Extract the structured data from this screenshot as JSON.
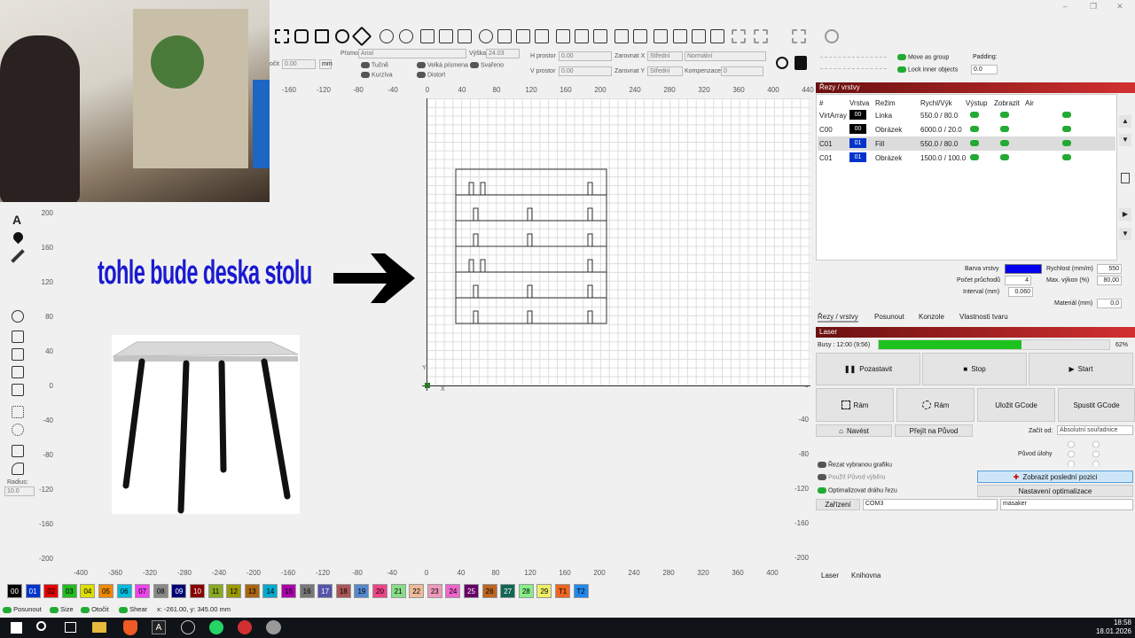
{
  "window": {
    "controls": [
      "–",
      "❐",
      "✕"
    ]
  },
  "toolbar": {
    "font_label": "Písmo",
    "font_value": "Arial",
    "height_label": "Výška",
    "height_value": "24.03",
    "h_space_label": "H prostor",
    "h_space_value": "0.00",
    "v_space_label": "V prostor",
    "v_space_value": "0.00",
    "align_x_label": "Zarovnat X",
    "align_x_value": "Střední",
    "align_y_label": "Zarovnat Y",
    "align_y_value": "Střední",
    "normal_value": "Normální",
    "compensation_label": "Kompenzace",
    "compensation_value": "0",
    "bold": "Tučně",
    "italic": "Kurzíva",
    "caps": "Velká písmena",
    "welded": "Svařeno",
    "distort": "Distort",
    "rotate_label": "očit",
    "rotate_value": "0.00",
    "unit": "mm",
    "move_as_group": "Move as group",
    "lock_inner": "Lock inner objects",
    "padding_label": "Padding:",
    "padding_value": "0.0"
  },
  "ruler_top": [
    "-160",
    "-120",
    "-80",
    "-40",
    "0",
    "40",
    "80",
    "120",
    "160",
    "200",
    "240",
    "280",
    "320",
    "360",
    "400",
    "440"
  ],
  "ruler_bottom": [
    "-400",
    "-360",
    "-320",
    "-280",
    "-240",
    "-200",
    "-160",
    "-120",
    "-80",
    "-40",
    "0",
    "40",
    "80",
    "120",
    "160",
    "200",
    "240",
    "280",
    "320",
    "360",
    "400"
  ],
  "ruler_left": [
    "200",
    "160",
    "120",
    "80",
    "40",
    "0",
    "-40",
    "-80",
    "-120",
    "-160",
    "-200"
  ],
  "ruler_right": [
    "320",
    "280",
    "240",
    "200",
    "160",
    "120",
    "80",
    "40",
    "0",
    "-40",
    "-80",
    "-120",
    "-160",
    "-200"
  ],
  "canvas": {
    "annotation": "tohle bude deska stolu",
    "x_axis": "X",
    "y_axis": "Y"
  },
  "sidebar": {
    "radius_label": "Radius:",
    "radius_value": "10.0"
  },
  "cuts": {
    "title": "Řezy / vrstvy",
    "headers": [
      "#",
      "Vrstva",
      "Režim",
      "Rychl/Výk",
      "Výstup",
      "Zobrazit",
      "Air"
    ],
    "rows": [
      {
        "name": "VirtArray",
        "layer": "00",
        "layer_color": "#000000",
        "mode": "Linka",
        "speed": "550.0 / 80.0"
      },
      {
        "name": "C00",
        "layer": "00",
        "layer_color": "#000000",
        "mode": "Obrázek",
        "speed": "6000.0 / 20.0"
      },
      {
        "name": "C01",
        "layer": "01",
        "layer_color": "#0033cc",
        "mode": "Fill",
        "speed": "550.0 / 80.0"
      },
      {
        "name": "C01",
        "layer": "01",
        "layer_color": "#0033cc",
        "mode": "Obrázek",
        "speed": "1500.0 / 100.0"
      }
    ],
    "layer_color_label": "Barva vrstvy",
    "layer_color": "#0000ee",
    "speed_label": "Rychlost (mm/m)",
    "speed_value": "550",
    "passes_label": "Počet průchodů",
    "passes_value": "4",
    "max_power_label": "Max. výkon (%)",
    "max_power_value": "80,00",
    "interval_label": "Interval (mm)",
    "interval_value": "0.060",
    "material_label": "Materiál (mm)",
    "material_value": "0,0",
    "tabs": [
      "Řezy / vrstvy",
      "Posunout",
      "Konzole",
      "Vlastnosti tvaru"
    ]
  },
  "laser": {
    "title": "Laser",
    "busy": "Busy : 12:00 (9:56)",
    "progress": 62,
    "progress_label": "62%",
    "pause": "Pozastavit",
    "stop": "Stop",
    "start": "Start",
    "frame1": "Rám",
    "frame2": "Rám",
    "save_gcode": "Uložit GCode",
    "run_gcode": "Spustit GCode",
    "home": "Navést",
    "go_origin": "Přejít na Původ",
    "start_from_label": "Začít od:",
    "start_from_value": "Absolutní souřadnice",
    "job_origin_label": "Původ úlohy",
    "cut_selected": "Řezat vybranou grafiku",
    "use_origin": "Použít Původ výběru",
    "optimize": "Optimalizovat dráhu řezu",
    "show_last": "Zobrazit poslední pozici",
    "opt_settings": "Nastavení optimalizace",
    "devices": "Zařízení",
    "port": "COM3",
    "device_name": "masaker",
    "tabs": [
      "Laser",
      "Knihovna"
    ]
  },
  "palette": [
    "00",
    "01",
    "02",
    "03",
    "04",
    "05",
    "06",
    "07",
    "08",
    "09",
    "10",
    "11",
    "12",
    "13",
    "14",
    "15",
    "16",
    "17",
    "18",
    "19",
    "20",
    "21",
    "22",
    "23",
    "24",
    "25",
    "26",
    "27",
    "28",
    "29",
    "T1",
    "T2"
  ],
  "palette_colors": [
    "#000000",
    "#0033cc",
    "#e00000",
    "#22bb22",
    "#dddd00",
    "#ee8800",
    "#00bbdd",
    "#ee44ee",
    "#888888",
    "#000077",
    "#880000",
    "#88aa22",
    "#999900",
    "#aa6611",
    "#00aacc",
    "#aa00aa",
    "#777777",
    "#5555aa",
    "#aa5555",
    "#5588cc",
    "#ee4488",
    "#88dd88",
    "#eebb99",
    "#ee99bb",
    "#ee66cc",
    "#660066",
    "#bb6622",
    "#116655",
    "#88ee88",
    "#eeee66",
    "#ee6622",
    "#2288ee"
  ],
  "status": {
    "move": "Posunout",
    "size": "Size",
    "rotate": "Otočit",
    "shear": "Shear",
    "coords": "x: -261.00, y: 345.00 mm"
  },
  "clock": {
    "time": "18:58",
    "date": "18.01.2026"
  }
}
